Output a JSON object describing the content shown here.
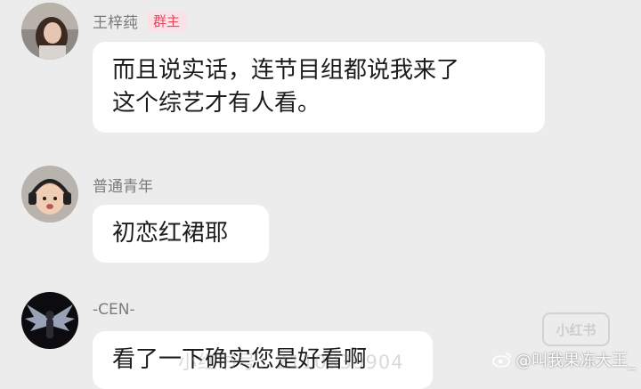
{
  "messages": [
    {
      "sender": "王梓莼",
      "badge": "群主",
      "text": "而且说实话，连节目组都说我来了\n这个综艺才有人看。",
      "avatar_icon": "woman-photo-avatar"
    },
    {
      "sender": "普通青年",
      "badge": "",
      "text": "初恋红裙耶",
      "avatar_icon": "child-headphones-avatar"
    },
    {
      "sender": "-CEN-",
      "badge": "",
      "text": "看了一下确实您是好看啊",
      "avatar_icon": "winged-figure-avatar"
    }
  ],
  "watermarks": {
    "weibo_handle": "@叫我果冻大王_",
    "center_text": "小红书号：2110939904",
    "logo_text": "小红书"
  },
  "colors": {
    "background": "#ececec",
    "bubble": "#ffffff",
    "badge_text": "#e8485f",
    "badge_bg": "#fbe1e5"
  }
}
